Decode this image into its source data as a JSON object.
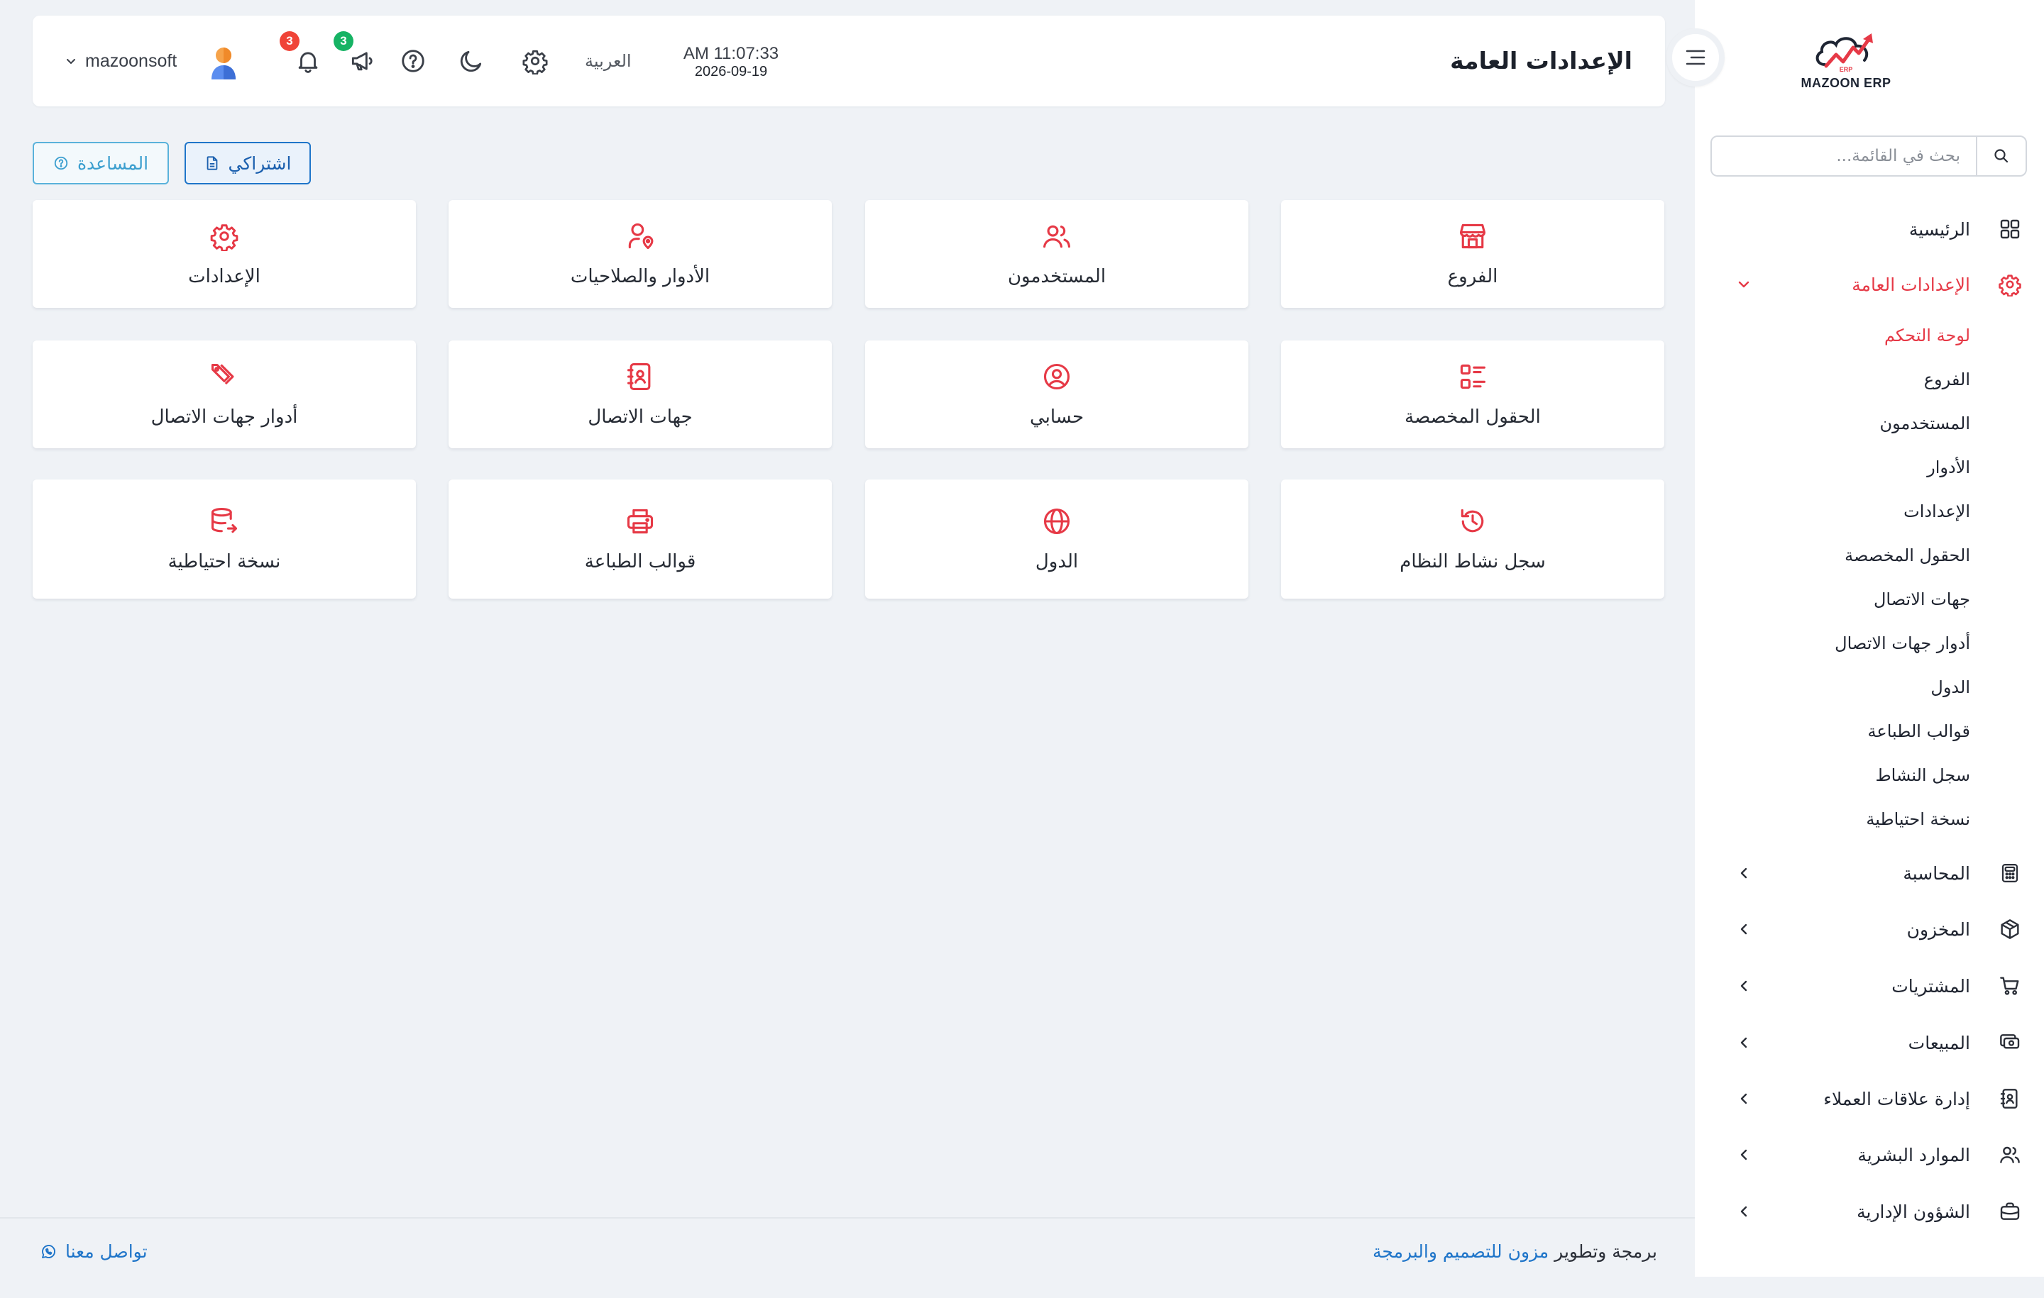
{
  "brand": {
    "logo_text": "MAZOON ERP",
    "logo_small": "ERP"
  },
  "colors": {
    "accent": "#e63946",
    "link": "#1f75c9",
    "green_badge": "#16b364",
    "red_badge": "#f04438"
  },
  "search": {
    "placeholder": "بحث في القائمة..."
  },
  "sidebar": {
    "home": "الرئيسية",
    "general_settings": "الإعدادات العامة",
    "sub": [
      "لوحة التحكم",
      "الفروع",
      "المستخدمون",
      "الأدوار",
      "الإعدادات",
      "الحقول المخصصة",
      "جهات الاتصال",
      "أدوار جهات الاتصال",
      "الدول",
      "قوالب الطباعة",
      "سجل النشاط",
      "نسخة احتياطية"
    ],
    "modules": [
      {
        "label": "المحاسبة",
        "icon": "calculator-icon"
      },
      {
        "label": "المخزون",
        "icon": "box-icon"
      },
      {
        "label": "المشتريات",
        "icon": "cart-icon"
      },
      {
        "label": "المبيعات",
        "icon": "cash-icon"
      },
      {
        "label": "إدارة علاقات العملاء",
        "icon": "contacts-book-icon"
      },
      {
        "label": "الموارد البشرية",
        "icon": "users-icon"
      },
      {
        "label": "الشؤون الإدارية",
        "icon": "briefcase-icon"
      }
    ]
  },
  "header": {
    "title": "الإعدادات العامة",
    "time": "AM 11:07:33",
    "date": "2026-09-19",
    "language": "العربية",
    "announcements_count": "3",
    "notifications_count": "3",
    "username": "mazoonsoft"
  },
  "actions": {
    "subscription": "اشتراكي",
    "help": "المساعدة"
  },
  "cards": [
    {
      "label": "الفروع",
      "icon": "store-icon"
    },
    {
      "label": "المستخدمون",
      "icon": "users-icon"
    },
    {
      "label": "الأدوار والصلاحيات",
      "icon": "user-pin-icon"
    },
    {
      "label": "الإعدادات",
      "icon": "gear-icon"
    },
    {
      "label": "الحقول المخصصة",
      "icon": "list-fields-icon"
    },
    {
      "label": "حسابي",
      "icon": "user-circle-icon"
    },
    {
      "label": "جهات الاتصال",
      "icon": "address-book-icon"
    },
    {
      "label": "أدوار جهات الاتصال",
      "icon": "tags-icon"
    },
    {
      "label": "سجل نشاط النظام",
      "icon": "history-icon"
    },
    {
      "label": "الدول",
      "icon": "globe-icon"
    },
    {
      "label": "قوالب الطباعة",
      "icon": "printer-icon"
    },
    {
      "label": "نسخة احتياطية",
      "icon": "database-export-icon"
    }
  ],
  "footer": {
    "credit_prefix": "برمجة وتطوير",
    "credit_brand": "مزون للتصميم والبرمجة",
    "contact": "تواصل معنا"
  }
}
